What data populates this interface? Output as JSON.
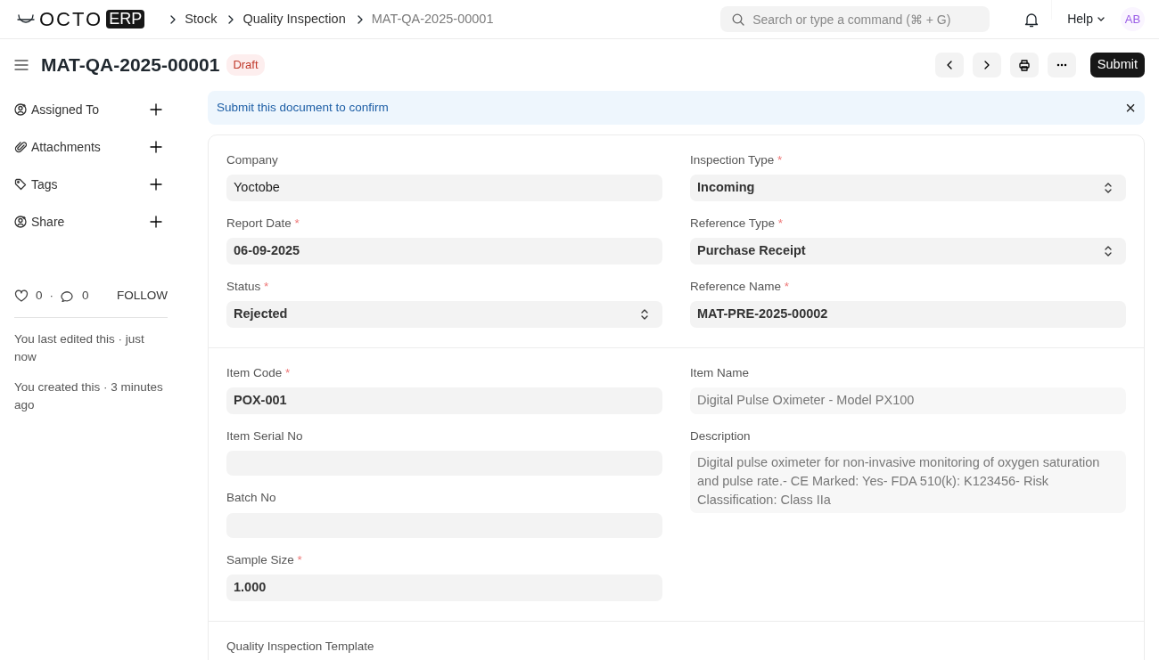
{
  "navbar": {
    "logo_text": "OCTO",
    "logo_badge": "ERP",
    "breadcrumbs": [
      {
        "label": "Stock",
        "current": false
      },
      {
        "label": "Quality Inspection",
        "current": false
      },
      {
        "label": "MAT-QA-2025-00001",
        "current": true
      }
    ],
    "search": {
      "placeholder": "Search or type a command (⌘ + G)"
    },
    "help": "Help",
    "avatar": "AB"
  },
  "page_header": {
    "title": "MAT-QA-2025-00001",
    "status": "Draft",
    "submit": "Submit"
  },
  "sidebar": {
    "items": [
      {
        "label": "Assigned To"
      },
      {
        "label": "Attachments"
      },
      {
        "label": "Tags"
      },
      {
        "label": "Share"
      }
    ],
    "likes": "0",
    "separator": "·",
    "comments": "0",
    "follow": "FOLLOW",
    "activity": [
      "You last edited this · just now",
      "You created this · 3 minutes ago"
    ]
  },
  "alert": {
    "text": "Submit this document to confirm",
    "close": "×"
  },
  "sections": [
    {
      "columns": [
        [
          {
            "label": "Company",
            "kind": "plain",
            "value": "Yoctobe"
          },
          {
            "label": "Report Date",
            "required_mark": "*",
            "kind": "data",
            "value": "06-09-2025"
          },
          {
            "label": "Status",
            "required_mark": "*",
            "kind": "select",
            "value": "Rejected"
          }
        ],
        [
          {
            "label": "Inspection Type",
            "required_mark": "*",
            "kind": "select",
            "value": "Incoming"
          },
          {
            "label": "Reference Type",
            "required_mark": "*",
            "kind": "select",
            "value": "Purchase Receipt"
          },
          {
            "label": "Reference Name",
            "required_mark": "*",
            "kind": "data",
            "value": "MAT-PRE-2025-00002"
          }
        ]
      ]
    },
    {
      "columns": [
        [
          {
            "label": "Item Code",
            "required_mark": "*",
            "kind": "data",
            "value": "POX-001"
          },
          {
            "label": "Item Serial No",
            "kind": "data"
          },
          {
            "label": "Batch No",
            "kind": "data"
          },
          {
            "label": "Sample Size",
            "required_mark": "*",
            "kind": "data",
            "value": "1.000"
          }
        ],
        [
          {
            "label": "Item Name",
            "kind": "readonly",
            "value": "Digital Pulse Oximeter - Model PX100"
          },
          {
            "label": "Description",
            "kind": "readonly_text",
            "value": "Digital pulse oximeter for non-invasive monitoring of oxygen saturation and pulse rate.- CE Marked: Yes- FDA 510(k): K123456- Risk Classification: Class IIa"
          }
        ]
      ]
    },
    {
      "columns": [
        [
          {
            "label": "Quality Inspection Template",
            "kind": "label_only"
          }
        ],
        []
      ]
    }
  ]
}
